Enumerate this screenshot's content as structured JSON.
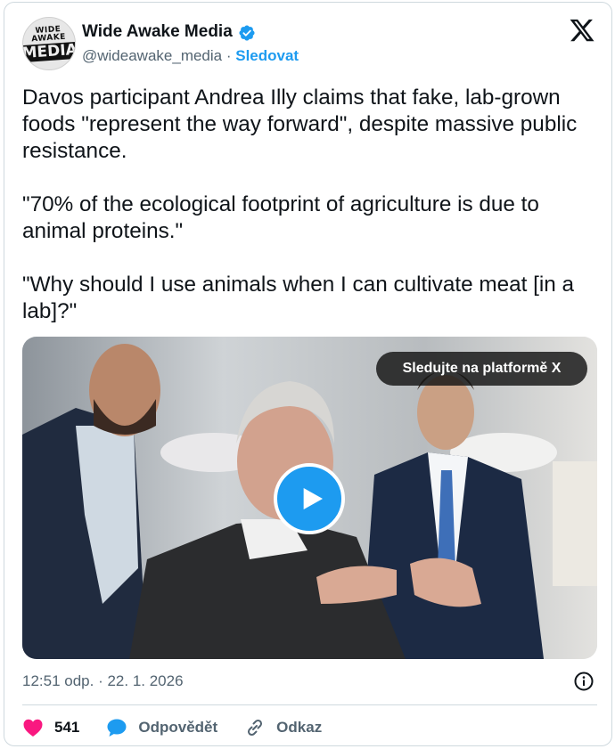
{
  "author": {
    "name": "Wide Awake Media",
    "handle": "@wideawake_media",
    "separator": " · ",
    "follow_label": "Sledovat",
    "avatar_text_top": "WIDE AWAKE",
    "avatar_text_bottom": "MEDIA"
  },
  "tweet": {
    "text": "Davos participant Andrea Illy claims that fake, lab-grown foods \"represent the way forward\", despite massive public resistance.\n\n\"70% of the ecological footprint of agriculture is due to animal proteins.\"\n\n\"Why should I use animals when I can cultivate meat [in a lab]?\""
  },
  "media": {
    "watch_label": "Sledujte na platformě X"
  },
  "meta": {
    "timestamp": "12:51 odp. · 22. 1. 2026"
  },
  "actions": {
    "likes": "541",
    "reply_label": "Odpovědět",
    "link_label": "Odkaz"
  },
  "colors": {
    "accent": "#1d9bf0",
    "like": "#f91880",
    "secondary_text": "#536471"
  },
  "icons": [
    "verified-badge-icon",
    "x-logo-icon",
    "play-icon",
    "info-icon",
    "heart-icon",
    "reply-bubble-icon",
    "link-icon"
  ]
}
